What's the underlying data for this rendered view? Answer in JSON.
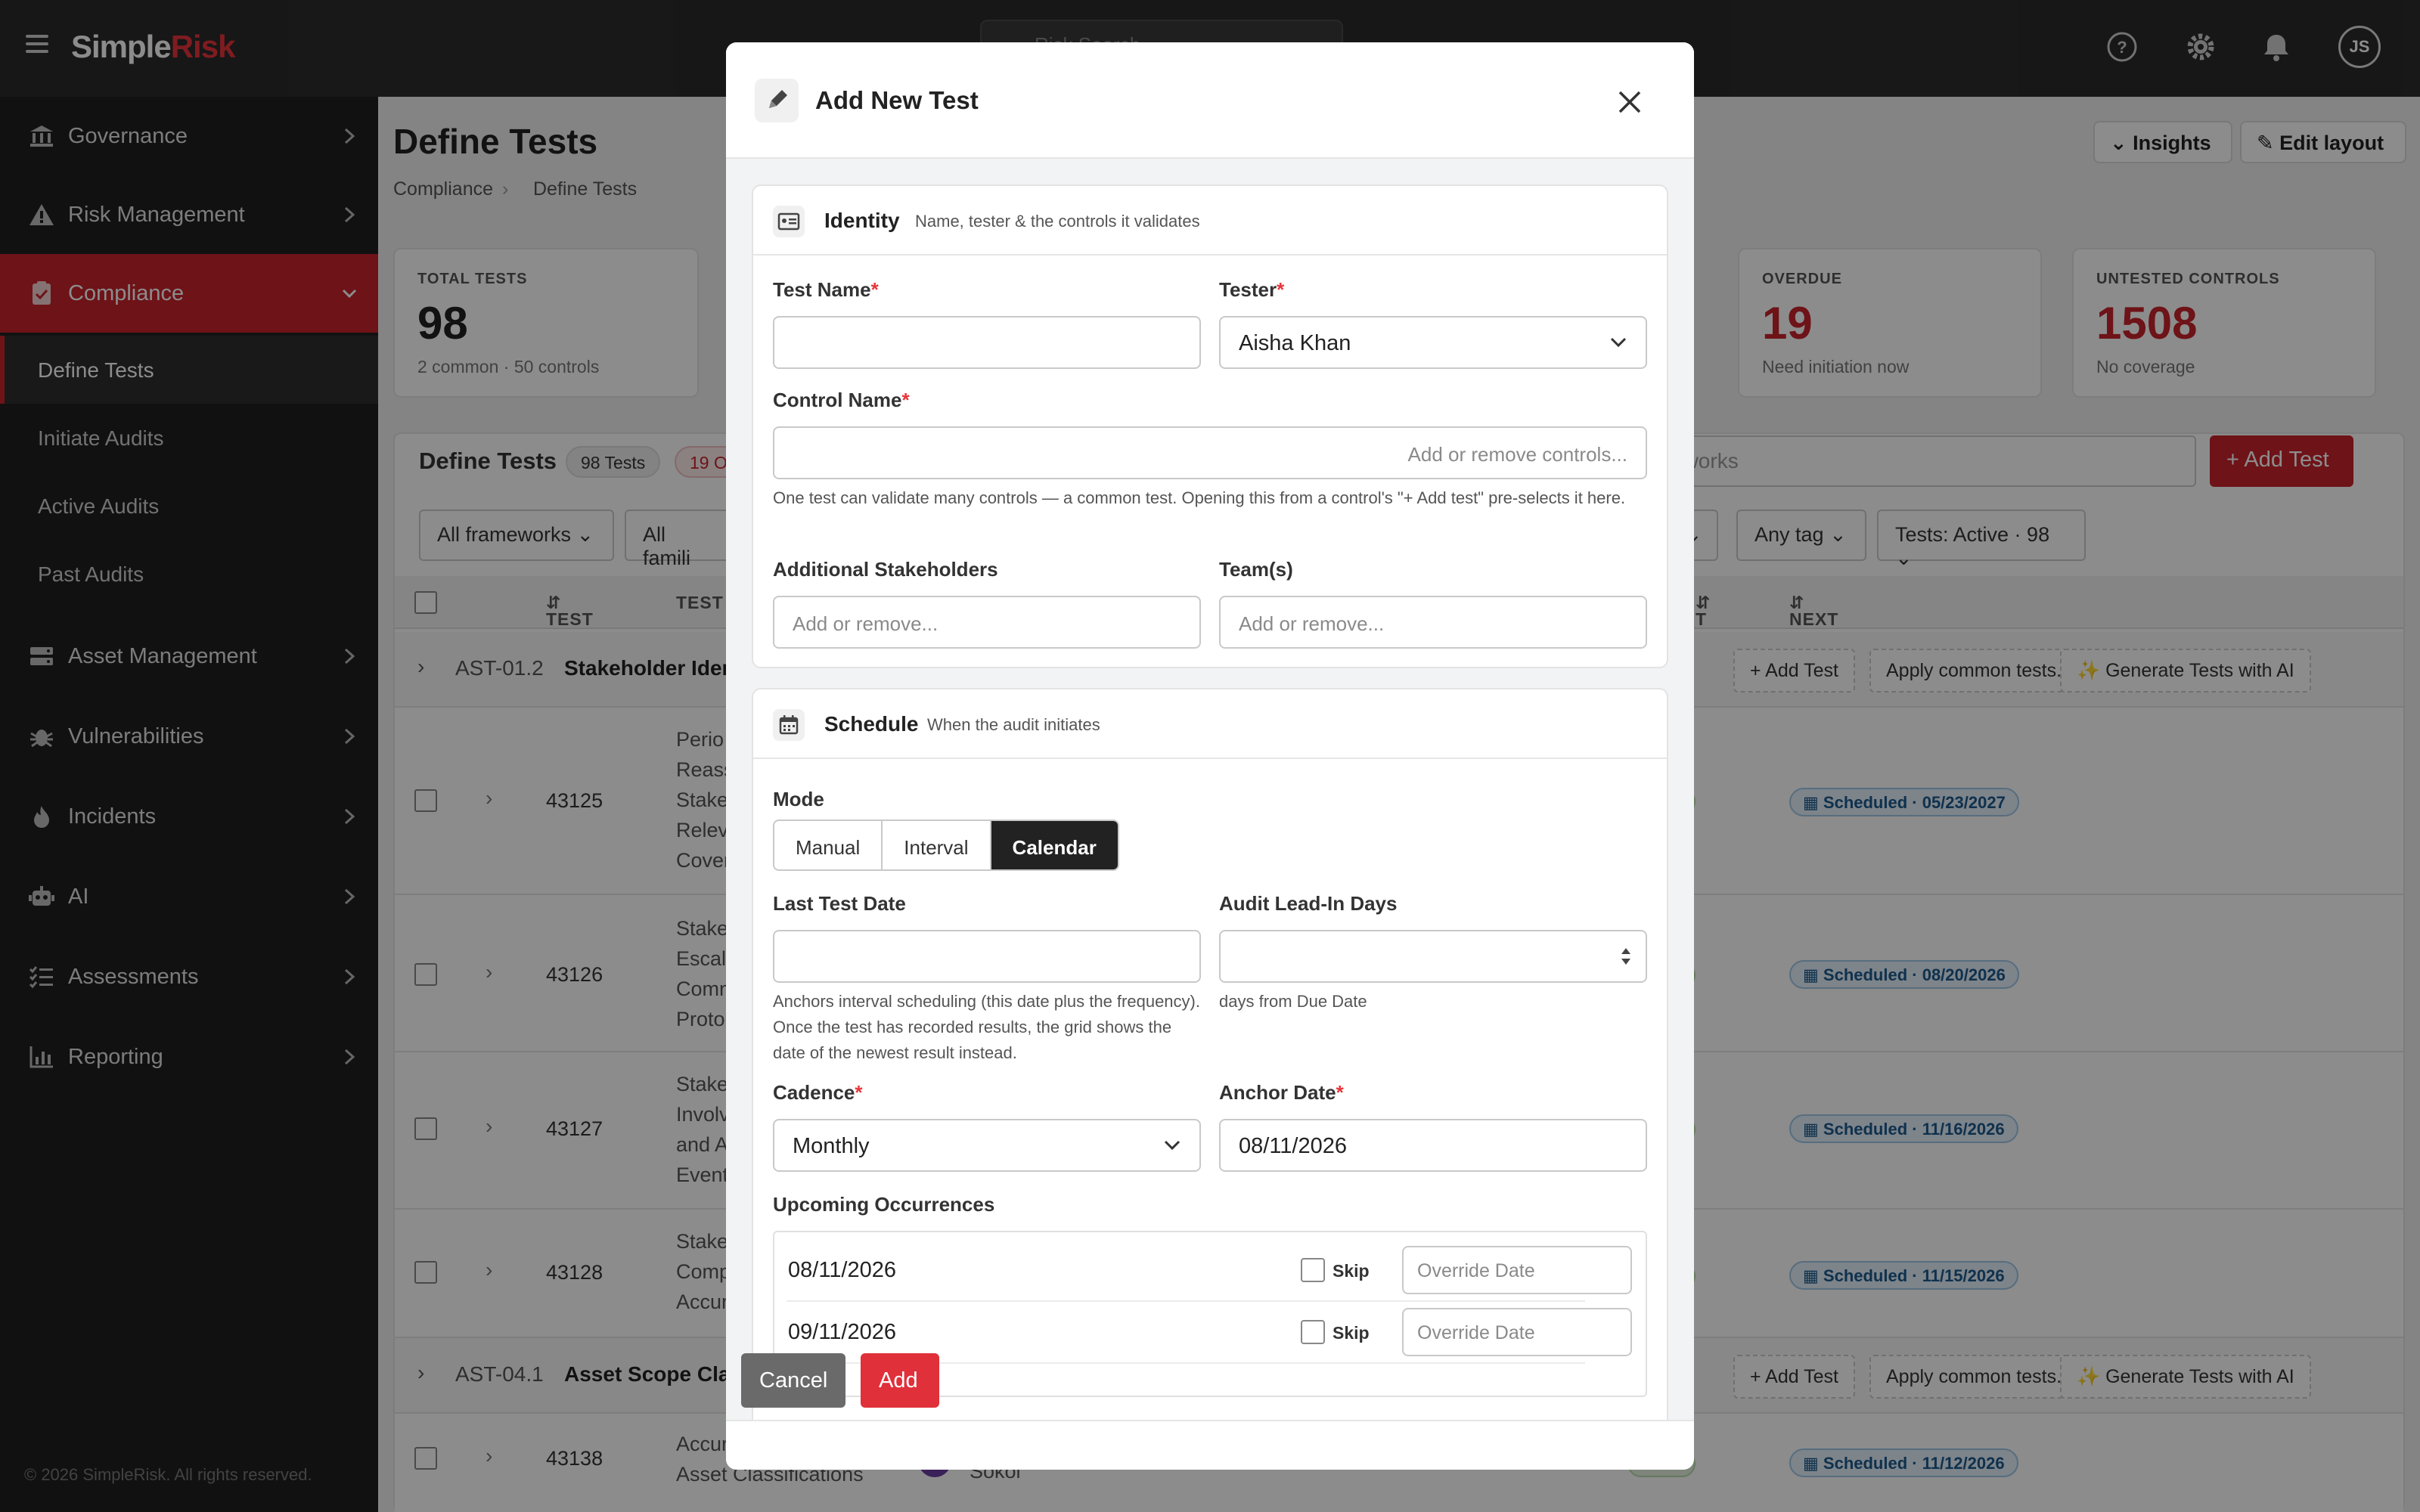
{
  "app": {
    "brand_a": "Simple",
    "brand_b": "Risk",
    "search_placeholder": "Risk Search...",
    "user_initials": "JS"
  },
  "sidebar": {
    "items": [
      {
        "label": "Governance"
      },
      {
        "label": "Risk Management"
      },
      {
        "label": "Compliance"
      },
      {
        "label": "Asset Management"
      },
      {
        "label": "Vulnerabilities"
      },
      {
        "label": "Incidents"
      },
      {
        "label": "AI"
      },
      {
        "label": "Assessments"
      },
      {
        "label": "Reporting"
      }
    ],
    "sub": [
      "Define Tests",
      "Initiate Audits",
      "Active Audits",
      "Past Audits"
    ],
    "footer": "© 2026 SimpleRisk. All rights reserved."
  },
  "page": {
    "title": "Define Tests",
    "breadcrumb": [
      "Compliance",
      "Define Tests"
    ],
    "insights_label": "Insights",
    "edit_layout_label": "Edit layout"
  },
  "cards": [
    {
      "title": "TOTAL TESTS",
      "value": "98",
      "sub": "2 common · 50 controls"
    },
    {
      "title": "OVERDUE",
      "value": "19",
      "sub": "Need initiation now"
    },
    {
      "title": "UNTESTED CONTROLS",
      "value": "1508",
      "sub": "No coverage"
    }
  ],
  "table": {
    "title": "Define Tests",
    "pill_count": "98 Tests",
    "pill_red": "19 O",
    "search_placeholder": "eworks",
    "add_label": "+ Add Test",
    "filters": [
      "All frameworks",
      "All famili",
      "Any tag",
      "Tests: Active · 98"
    ],
    "headers": [
      "TEST ID",
      "TEST",
      "T",
      "NEXT DUE"
    ],
    "group_actions": [
      "+ Add Test",
      "Apply common tests...",
      "✨ Generate Tests with AI"
    ],
    "groups": [
      {
        "id": "AST-01.2",
        "name": "Stakeholder Iden"
      },
      {
        "id": "AST-04.1",
        "name": "Asset Scope Clas"
      }
    ],
    "rows": [
      {
        "id": "43125",
        "lines": [
          "Perio",
          "Reass",
          "Stake",
          "Relev",
          "Cover"
        ],
        "next": "Scheduled · 05/23/2027"
      },
      {
        "id": "43126",
        "lines": [
          "Stake",
          "Escal",
          "Comn",
          "Proto"
        ],
        "next": "Scheduled · 08/20/2026"
      },
      {
        "id": "43127",
        "lines": [
          "Stake",
          "Involv",
          "and A",
          "Event"
        ],
        "next": "Scheduled · 11/16/2026"
      },
      {
        "id": "43128",
        "lines": [
          "Stake",
          "Comp",
          "Accur"
        ],
        "next": "Scheduled · 11/15/2026"
      },
      {
        "id": "43138",
        "lines": [
          "Accur",
          "Asset Classifications"
        ],
        "owner": "Sokol",
        "next": "Scheduled · 11/12/2026"
      }
    ]
  },
  "modal": {
    "title": "Add New Test",
    "identity": {
      "title": "Identity",
      "desc": "Name, tester & the controls it validates",
      "test_name_label": "Test Name",
      "test_name_value": "",
      "tester_label": "Tester",
      "tester_value": "Aisha Khan",
      "control_label": "Control Name",
      "control_placeholder": "Add or remove controls...",
      "control_help": "One test can validate many controls — a common test. Opening this from a control's \"+ Add test\" pre-selects it here.",
      "stakeholders_label": "Additional Stakeholders",
      "stakeholders_placeholder": "Add or remove...",
      "teams_label": "Team(s)",
      "teams_placeholder": "Add or remove..."
    },
    "schedule": {
      "title": "Schedule",
      "desc": "When the audit initiates",
      "mode_label": "Mode",
      "modes": [
        "Manual",
        "Interval",
        "Calendar"
      ],
      "mode_selected": "Calendar",
      "last_test_label": "Last Test Date",
      "last_test_value": "",
      "last_test_help": "Anchors interval scheduling (this date plus the frequency). Once the test has recorded results, the grid shows the date of the newest result instead.",
      "leadin_label": "Audit Lead-In Days",
      "leadin_value": "",
      "leadin_help": "days from Due Date",
      "cadence_label": "Cadence",
      "cadence_value": "Monthly",
      "anchor_label": "Anchor Date",
      "anchor_value": "08/11/2026",
      "occ_label": "Upcoming Occurrences",
      "occurrences": [
        {
          "date": "08/11/2026",
          "skip_label": "Skip",
          "override_placeholder": "Override Date"
        },
        {
          "date": "09/11/2026",
          "skip_label": "Skip",
          "override_placeholder": "Override Date"
        }
      ]
    },
    "cancel_label": "Cancel",
    "add_label": "Add"
  }
}
